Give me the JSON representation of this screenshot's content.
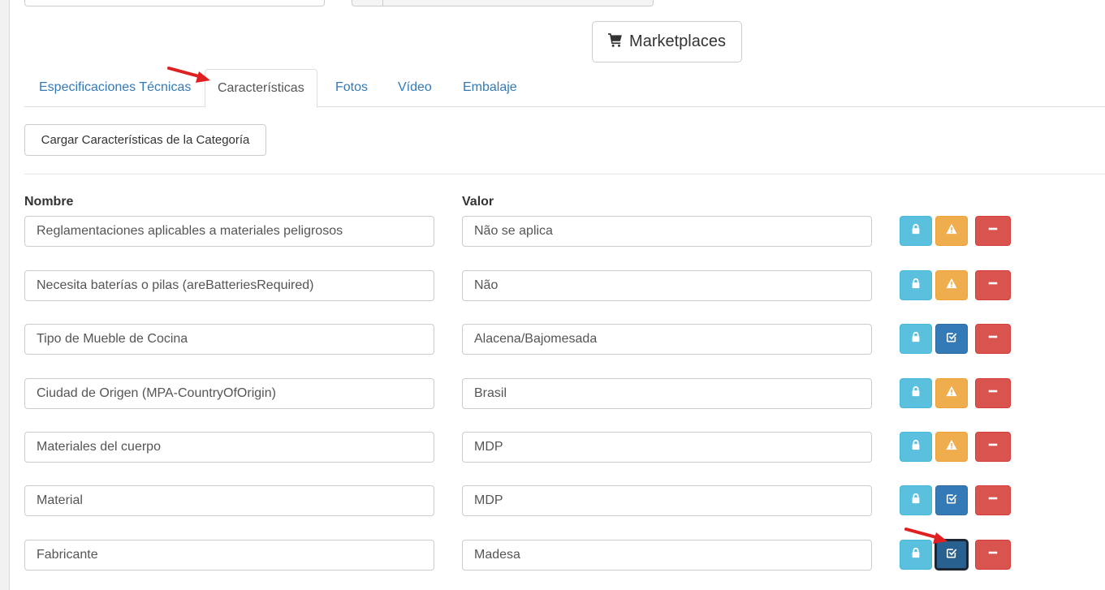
{
  "header": {
    "marketplaces_label": "Marketplaces",
    "cart_icon": "shopping-cart-icon"
  },
  "tabs": [
    {
      "label": "Especificaciones Técnicas",
      "active": false
    },
    {
      "label": "Características",
      "active": true
    },
    {
      "label": "Fotos",
      "active": false
    },
    {
      "label": "Vídeo",
      "active": false
    },
    {
      "label": "Embalaje",
      "active": false
    }
  ],
  "load_button": {
    "label": "Cargar Características de la Categoría"
  },
  "columns": {
    "name": "Nombre",
    "value": "Valor"
  },
  "rows": [
    {
      "name": "Reglamentaciones aplicables a materiales peligrosos",
      "value": "Não se aplica",
      "status": "warning"
    },
    {
      "name": "Necesita baterías o pilas (areBatteriesRequired)",
      "value": "Não",
      "status": "warning"
    },
    {
      "name": "Tipo de Mueble de Cocina",
      "value": "Alacena/Bajomesada",
      "status": "checked"
    },
    {
      "name": "Ciudad de Origen (MPA-CountryOfOrigin)",
      "value": "Brasil",
      "status": "warning"
    },
    {
      "name": "Materiales del cuerpo",
      "value": "MDP",
      "status": "warning"
    },
    {
      "name": "Material",
      "value": "MDP",
      "status": "checked"
    },
    {
      "name": "Fabricante",
      "value": "Madesa",
      "status": "checked"
    }
  ],
  "colors": {
    "link": "#337ab7",
    "info": "#5bc0de",
    "warning": "#f0ad4e",
    "primary": "#337ab7",
    "danger": "#d9534f",
    "annotation_arrow": "#e02020"
  }
}
